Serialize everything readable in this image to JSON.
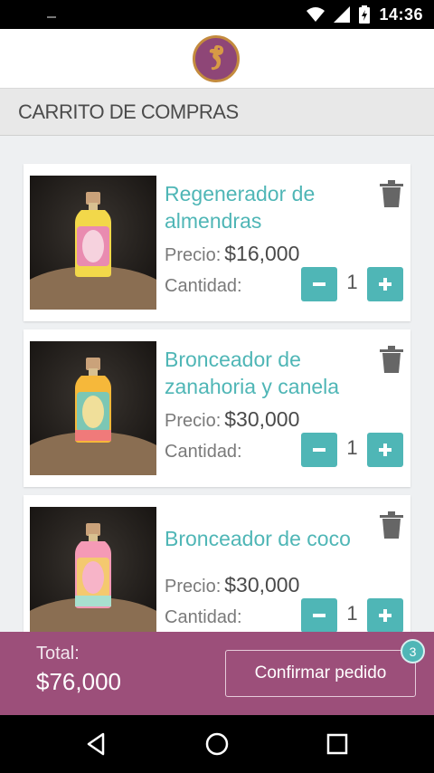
{
  "status_bar": {
    "time": "14:36"
  },
  "header": {
    "logo_icon": "seahorse-logo-icon"
  },
  "page": {
    "title": "CARRITO DE COMPRAS"
  },
  "cart": {
    "price_label": "Precio:",
    "quantity_label": "Cantidad:",
    "items": [
      {
        "name": "Regenerador de almendras",
        "price": "$16,000",
        "quantity": "1"
      },
      {
        "name": "Bronceador de zanahoria y canela",
        "price": "$30,000",
        "quantity": "1"
      },
      {
        "name": "Bronceador de coco",
        "price": "$30,000",
        "quantity": "1"
      }
    ]
  },
  "footer": {
    "total_label": "Total:",
    "total_value": "$76,000",
    "confirm_label": "Confirmar pedido",
    "badge_count": "3"
  },
  "colors": {
    "accent": "#4fb6b6",
    "footer": "#9c4f7a",
    "logo": "#8e4677"
  },
  "nav_bar": {
    "icons": [
      "back-icon",
      "home-icon",
      "recents-icon"
    ]
  }
}
